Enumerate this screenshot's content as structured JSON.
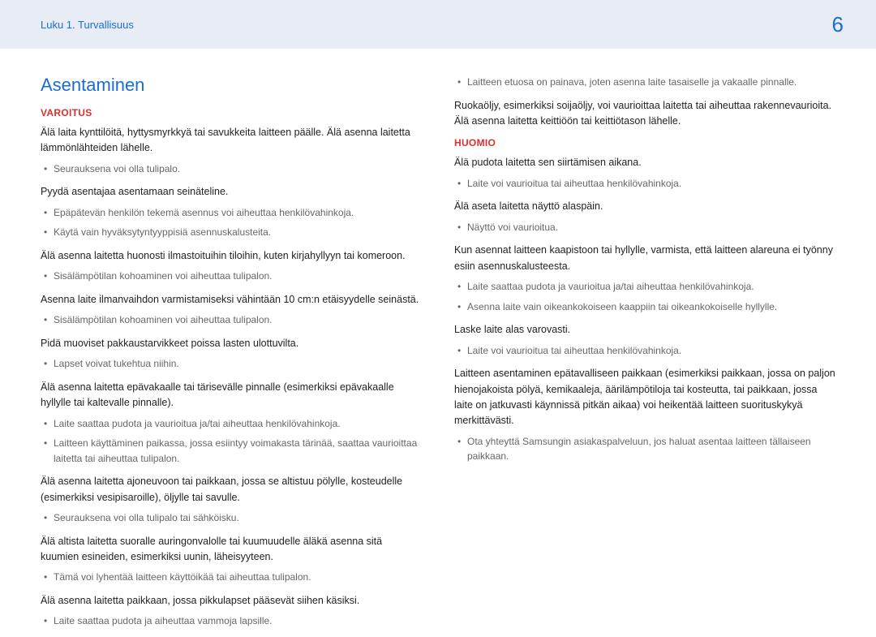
{
  "header": {
    "chapter": "Luku 1. Turvallisuus",
    "page": "6"
  },
  "left": {
    "title": "Asentaminen",
    "warning": "VAROITUS",
    "p1": "Älä laita kynttilöitä, hyttysmyrkkyä tai savukkeita laitteen päälle. Älä asenna laitetta lämmönlähteiden lähelle.",
    "b1": "Seurauksena voi olla tulipalo.",
    "p2": "Pyydä asentajaa asentamaan seinäteline.",
    "b2a": "Epäpätevän henkilön tekemä asennus voi aiheuttaa henkilövahinkoja.",
    "b2b": "Käytä vain hyväksytyntyyppisiä asennuskalusteita.",
    "p3": "Älä asenna laitetta huonosti ilmastoituihin tiloihin, kuten kirjahyllyyn tai komeroon.",
    "b3": "Sisälämpötilan kohoaminen voi aiheuttaa tulipalon.",
    "p4": "Asenna laite ilmanvaihdon varmistamiseksi vähintään 10 cm:n etäisyydelle seinästä.",
    "b4": "Sisälämpötilan kohoaminen voi aiheuttaa tulipalon.",
    "p5": "Pidä muoviset pakkaustarvikkeet poissa lasten ulottuvilta.",
    "b5": "Lapset voivat tukehtua niihin.",
    "p6": "Älä asenna laitetta epävakaalle tai tärisevälle pinnalle (esimerkiksi epävakaalle hyllylle tai kaltevalle pinnalle).",
    "b6a": "Laite saattaa pudota ja vaurioitua ja/tai aiheuttaa henkilövahinkoja.",
    "b6b": "Laitteen käyttäminen paikassa, jossa esiintyy voimakasta tärinää, saattaa vaurioittaa laitetta tai aiheuttaa tulipalon.",
    "p7": "Älä asenna laitetta ajoneuvoon tai paikkaan, jossa se altistuu pölylle, kosteudelle (esimerkiksi vesipisaroille), öljylle tai savulle.",
    "b7": "Seurauksena voi olla tulipalo tai sähköisku.",
    "p8": "Älä altista laitetta suoralle auringonvalolle tai kuumuudelle äläkä asenna sitä kuumien esineiden, esimerkiksi uunin, läheisyyteen.",
    "b8": "Tämä voi lyhentää laitteen käyttöikää tai aiheuttaa tulipalon.",
    "p9": "Älä asenna laitetta paikkaan, jossa pikkulapset pääsevät siihen käsiksi.",
    "b9": "Laite saattaa pudota ja aiheuttaa vammoja lapsille."
  },
  "right": {
    "b0": "Laitteen etuosa on painava, joten asenna laite tasaiselle ja vakaalle pinnalle.",
    "p0": "Ruokaöljy, esimerkiksi soijaöljy, voi vaurioittaa laitetta tai aiheuttaa rakennevaurioita. Älä asenna laitetta keittiöön tai keittiötason lähelle.",
    "notice": "HUOMIO",
    "p1": "Älä pudota laitetta sen siirtämisen aikana.",
    "b1": "Laite voi vaurioitua tai aiheuttaa henkilövahinkoja.",
    "p2": "Älä aseta laitetta näyttö alaspäin.",
    "b2": "Näyttö voi vaurioitua.",
    "p3": "Kun asennat laitteen kaapistoon tai hyllylle, varmista, että laitteen alareuna ei työnny esiin asennuskalusteesta.",
    "b3a": "Laite saattaa pudota ja vaurioitua ja/tai aiheuttaa henkilövahinkoja.",
    "b3b": "Asenna laite vain oikeankokoiseen kaappiin tai oikeankokoiselle hyllylle.",
    "p4": "Laske laite alas varovasti.",
    "b4": "Laite voi vaurioitua tai aiheuttaa henkilövahinkoja.",
    "p5": "Laitteen asentaminen epätavalliseen paikkaan (esimerkiksi paikkaan, jossa on paljon hienojakoista pölyä, kemikaaleja, äärilämpötiloja tai kosteutta, tai paikkaan, jossa laite on jatkuvasti käynnissä pitkän aikaa) voi heikentää laitteen suorituskykyä merkittävästi.",
    "b5": "Ota yhteyttä Samsungin asiakaspalveluun, jos haluat asentaa laitteen tällaiseen paikkaan."
  }
}
